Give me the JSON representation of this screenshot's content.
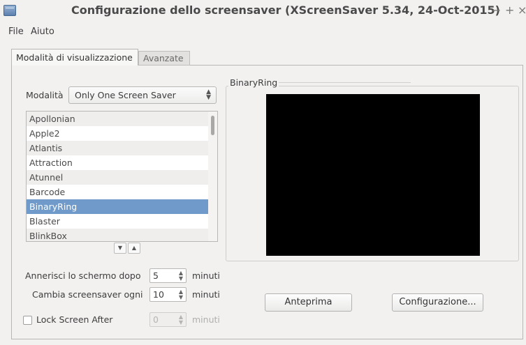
{
  "window": {
    "title": "Configurazione dello screensaver  (XScreenSaver 5.34, 24-Oct-2015)",
    "minimize": "−",
    "maximize": "+",
    "close": "×"
  },
  "menu": {
    "file": "File",
    "help": "Aiuto"
  },
  "tabs": {
    "display": "Modalità di visualizzazione",
    "advanced": "Avanzate"
  },
  "mode": {
    "label": "Modalità",
    "value": "Only One Screen Saver"
  },
  "savers": [
    "Apollonian",
    "Apple2",
    "Atlantis",
    "Attraction",
    "Atunnel",
    "Barcode",
    "BinaryRing",
    "Blaster",
    "BlinkBox"
  ],
  "selected_saver": "BinaryRing",
  "blank_after": {
    "label": "Annerisci lo schermo dopo",
    "value": "5",
    "unit": "minuti"
  },
  "cycle_after": {
    "label": "Cambia screensaver ogni",
    "value": "10",
    "unit": "minuti"
  },
  "lock_after": {
    "label": "Lock Screen After",
    "value": "0",
    "unit": "minuti",
    "checked": false
  },
  "preview": {
    "title": "BinaryRing",
    "preview_button": "Anteprima",
    "settings_button": "Configurazione..."
  }
}
